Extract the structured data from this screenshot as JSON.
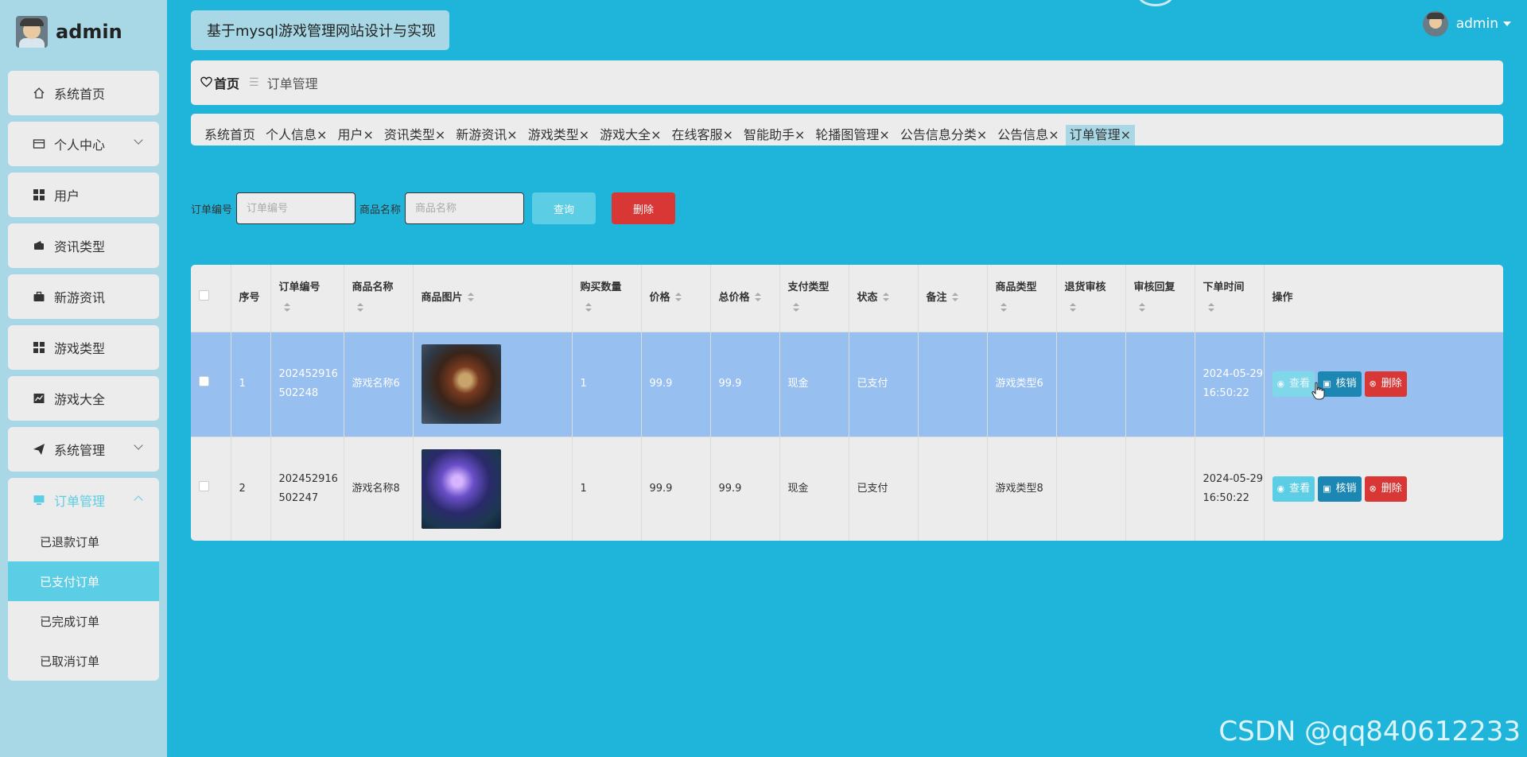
{
  "sidebar": {
    "username": "admin",
    "menu": [
      {
        "label": "系统首页",
        "icon": "home-icon"
      },
      {
        "label": "个人中心",
        "icon": "id-card-icon"
      },
      {
        "label": "用户",
        "icon": "grid-icon"
      },
      {
        "label": "资讯类型",
        "icon": "wallet-icon"
      },
      {
        "label": "新游资讯",
        "icon": "briefcase-icon"
      },
      {
        "label": "游戏类型",
        "icon": "grid-icon"
      },
      {
        "label": "游戏大全",
        "icon": "chart-icon"
      },
      {
        "label": "系统管理",
        "icon": "paper-plane-icon"
      },
      {
        "label": "订单管理",
        "icon": "monitor-icon"
      }
    ],
    "submenu": [
      "已退款订单",
      "已支付订单",
      "已完成订单",
      "已取消订单"
    ],
    "active_submenu": "已支付订单",
    "accent_color": "#5bcde4"
  },
  "header": {
    "site_title": "基于mysql游戏管理网站设计与实现",
    "user": "admin"
  },
  "breadcrumb": {
    "home": "首页",
    "current": "订单管理"
  },
  "tabs": [
    "系统首页",
    "个人信息",
    "用户",
    "资讯类型",
    "新游资讯",
    "游戏类型",
    "游戏大全",
    "在线客服",
    "智能助手",
    "轮播图管理",
    "公告信息分类",
    "公告信息",
    "订单管理"
  ],
  "active_tab": "订单管理",
  "search": {
    "order_no_label": "订单编号",
    "order_no_placeholder": "订单编号",
    "product_label": "商品名称",
    "product_placeholder": "商品名称",
    "query_button": "查询",
    "delete_button": "删除"
  },
  "table": {
    "columns": [
      "序号",
      "订单编号",
      "商品名称",
      "商品图片",
      "购买数量",
      "价格",
      "总价格",
      "支付类型",
      "状态",
      "备注",
      "商品类型",
      "退货审核",
      "审核回复",
      "下单时间",
      "操作"
    ],
    "rows": [
      {
        "index": "1",
        "order_no": "202452916502248",
        "product": "游戏名称6",
        "qty": "1",
        "price": "99.9",
        "total": "99.9",
        "pay_type": "现金",
        "status": "已支付",
        "remark": "",
        "category": "游戏类型6",
        "return_review": "",
        "review_reply": "",
        "time": "2024-05-29 16:50:22"
      },
      {
        "index": "2",
        "order_no": "202452916502247",
        "product": "游戏名称8",
        "qty": "1",
        "price": "99.9",
        "total": "99.9",
        "pay_type": "现金",
        "status": "已支付",
        "remark": "",
        "category": "游戏类型8",
        "return_review": "",
        "review_reply": "",
        "time": "2024-05-29 16:50:22"
      }
    ],
    "actions": {
      "view": "查看",
      "verify": "核销",
      "delete": "删除"
    },
    "selected_row_color": "#97bff0"
  },
  "watermark": "CSDN @qq840612233",
  "colors": {
    "background": "#1fb5db",
    "danger": "#d93636",
    "primary_dark": "#1d87b3"
  }
}
